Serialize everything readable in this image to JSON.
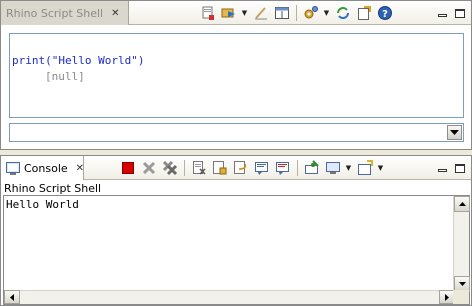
{
  "shell_view": {
    "tab_label": "Rhino Script Shell",
    "code": "print(\"Hello World\")",
    "result": "[null]",
    "input_value": "",
    "toolbar": [
      "clear-shell-icon",
      "run-icon",
      "reset-icon",
      "switch-layout-icon",
      "settings-icon",
      "refresh-icon",
      "load-script-icon",
      "help-icon"
    ]
  },
  "console_view": {
    "tab_label": "Console",
    "console_name": "Rhino Script Shell",
    "output": "Hello World",
    "toolbar": [
      "terminate-icon",
      "remove-launch-icon",
      "remove-all-terminated-icon",
      "clear-console-icon",
      "scroll-lock-icon",
      "word-wrap-icon",
      "show-on-stdout-icon",
      "show-on-stderr-icon",
      "pin-console-icon",
      "display-console-icon",
      "open-console-icon"
    ]
  },
  "colors": {
    "code": "#1a2ec7",
    "result": "#8a8a8a",
    "terminate": "#d40000"
  }
}
